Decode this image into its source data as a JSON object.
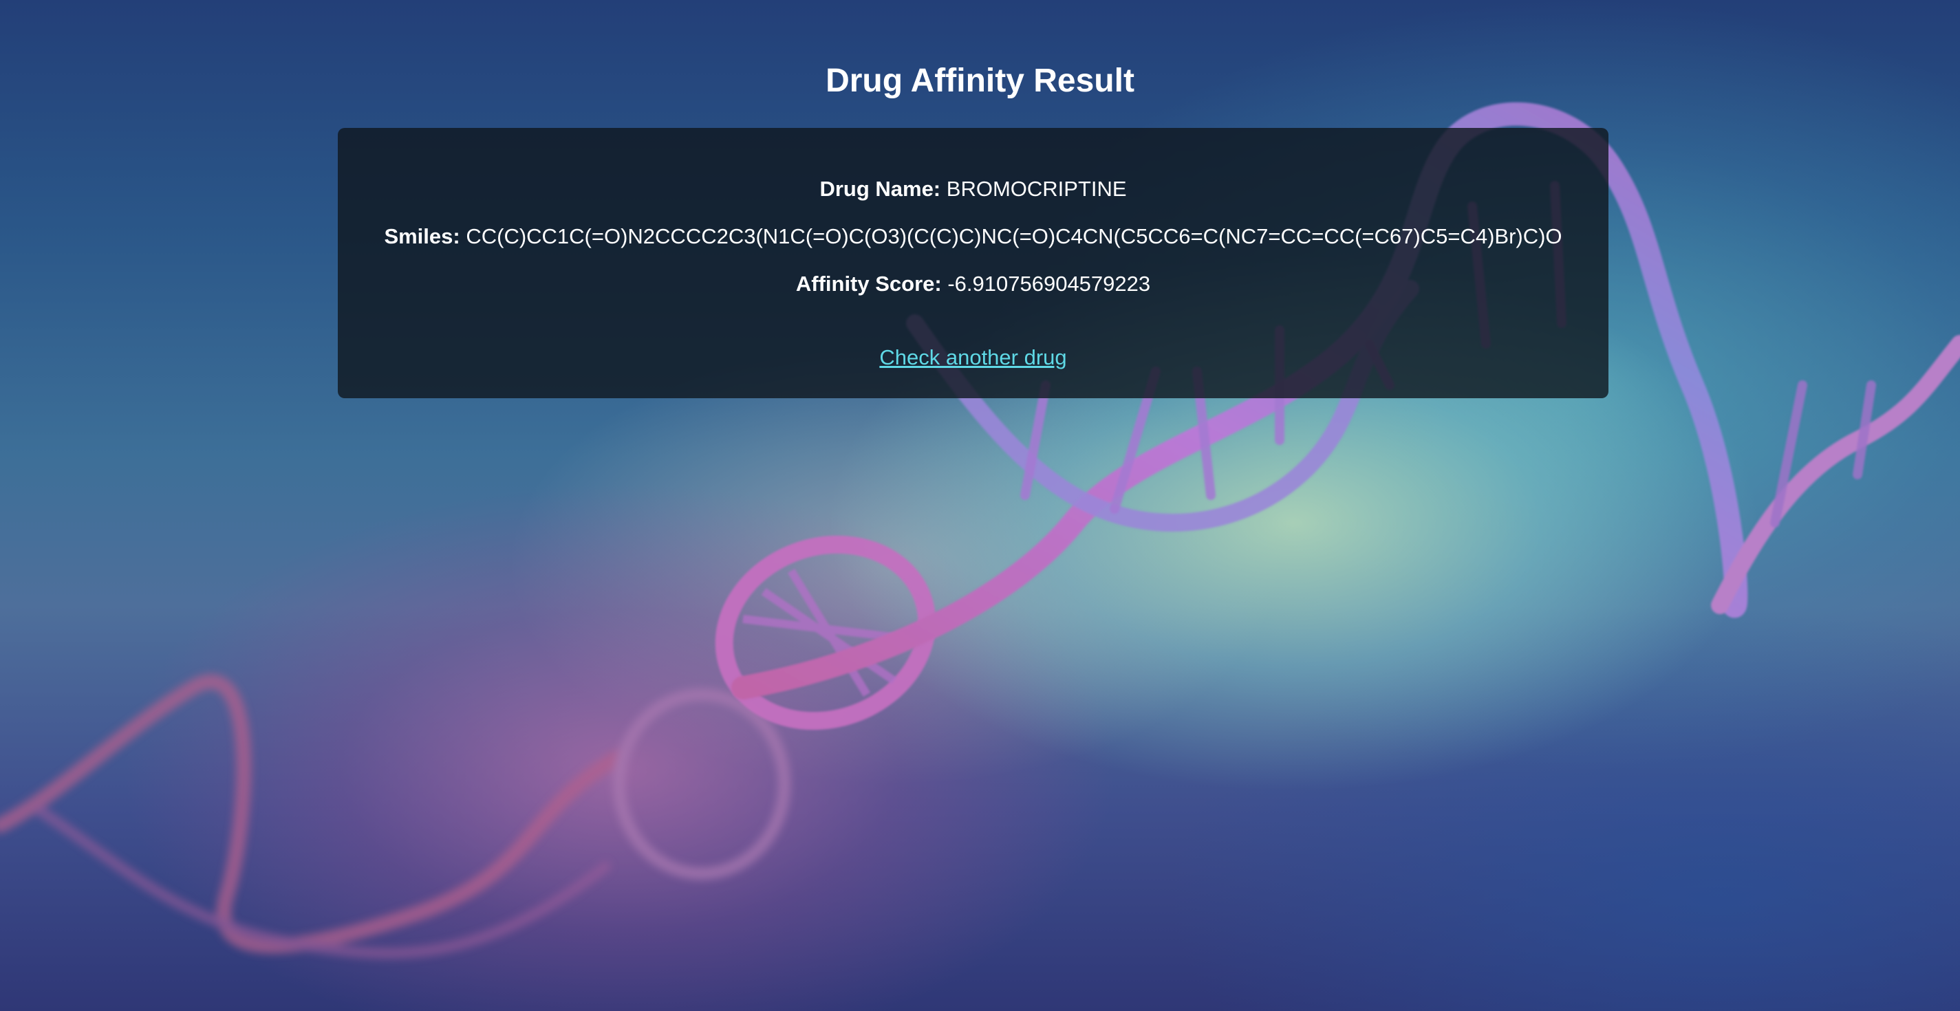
{
  "page": {
    "title": "Drug Affinity Result"
  },
  "result": {
    "drug_name_label": "Drug Name:",
    "drug_name_value": "BROMOCRIPTINE",
    "smiles_label": "Smiles:",
    "smiles_value": "CC(C)CC1C(=O)N2CCCC2C3(N1C(=O)C(O3)(C(C)C)NC(=O)C4CN(C5CC6=C(NC7=CC=CC(=C67)C5=C4)Br)C)O",
    "affinity_label": "Affinity Score:",
    "affinity_value": "-6.910756904579223"
  },
  "actions": {
    "check_another_label": "Check another drug"
  },
  "background": {
    "image": "dna-double-helix",
    "colors": {
      "top": "#233f78",
      "teal_glow": "#8fd2c8",
      "pink_glow": "#b86ea8",
      "bottom": "#2f3776"
    }
  },
  "colors": {
    "card_background": "#0f161e",
    "text": "#ffffff",
    "link": "#5fd9e6"
  }
}
